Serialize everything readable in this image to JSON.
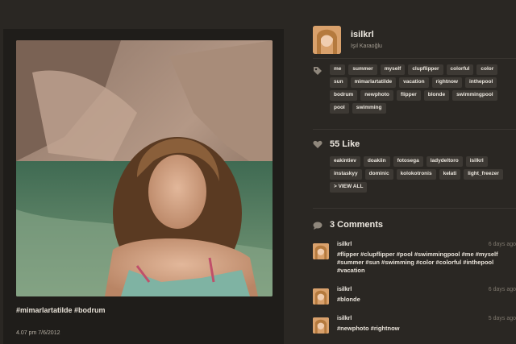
{
  "photo": {
    "caption": "#mimarlartatilde #bodrum",
    "timestamp": "4.07 pm 7/6/2012"
  },
  "profile": {
    "username": "isilkrl",
    "full_name": "Işıl Karaoğlu",
    "avatar": "user-avatar"
  },
  "tags": {
    "icon": "tag-icon",
    "items": [
      "me",
      "summer",
      "myself",
      "clupflipper",
      "colorful",
      "color",
      "sun",
      "mimarlartatilde",
      "vacation",
      "rightnow",
      "inthepool",
      "bodrum",
      "newphoto",
      "flipper",
      "blonde",
      "swimmingpool",
      "pool",
      "swimming"
    ]
  },
  "likes": {
    "icon": "heart-icon",
    "title": "55 Like",
    "users": [
      "eakintiev",
      "doakiin",
      "fotosega",
      "ladydeltoro",
      "isilkrl",
      "instaskyy",
      "dominic",
      "kolokotronis",
      "kelati",
      "light_freezer"
    ],
    "view_all": "> VIEW ALL"
  },
  "comments": {
    "icon": "speech-bubble-icon",
    "title": "3 Comments",
    "items": [
      {
        "user": "isilkrl",
        "time": "6 days ago",
        "text": "#flipper #clupflipper #pool #swimmingpool #me #myself #summer #sun #swimming #color #colorful #inthepool #vacation"
      },
      {
        "user": "isilkrl",
        "time": "6 days ago",
        "text": "#blonde"
      },
      {
        "user": "isilkrl",
        "time": "5 days ago",
        "text": "#newphoto #rightnow"
      }
    ]
  },
  "colors": {
    "background": "#2a2723",
    "panel": "#1f1d1a",
    "tag_bg": "#3d3934"
  }
}
